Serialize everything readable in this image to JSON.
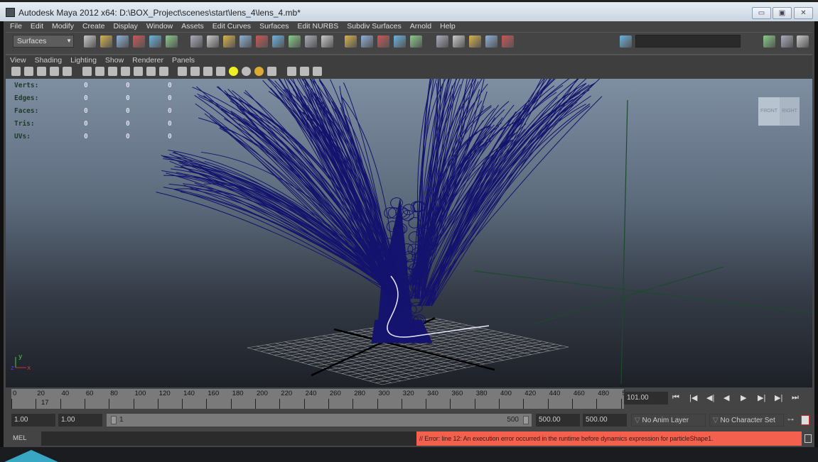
{
  "window": {
    "title": "Autodesk Maya 2012 x64: D:\\BOX_Project\\scenes\\start\\lens_4\\lens_4.mb*",
    "minimize": "▭",
    "maximize": "▣",
    "close": "✕"
  },
  "menu": [
    "File",
    "Edit",
    "Modify",
    "Create",
    "Display",
    "Window",
    "Assets",
    "Edit Curves",
    "Surfaces",
    "Edit NURBS",
    "Subdiv Surfaces",
    "Arnold",
    "Help"
  ],
  "toolbar": {
    "mode": "Surfaces",
    "icons": [
      "new-scene",
      "open-scene",
      "save-scene",
      "select-hierarchy",
      "select-object",
      "select-component",
      "move-tool",
      "select-tool",
      "lasso-tool",
      "paint-select",
      "snap-grid",
      "snap-curve",
      "snap-point",
      "snap-view-plane",
      "help",
      "lock",
      "input-ops",
      "history",
      "render",
      "ipr-render",
      "render-settings",
      "hypershade",
      "construction-history",
      "render-view",
      "show-outliner",
      "attribute-editor",
      "channel-box",
      "tool-settings",
      "layer-editor"
    ]
  },
  "panel": {
    "menu": [
      "View",
      "Shading",
      "Lighting",
      "Show",
      "Renderer",
      "Panels"
    ]
  },
  "hud": {
    "rows": [
      {
        "label": "Verts:",
        "values": [
          "0",
          "0",
          "0"
        ]
      },
      {
        "label": "Edges:",
        "values": [
          "0",
          "0",
          "0"
        ]
      },
      {
        "label": "Faces:",
        "values": [
          "0",
          "0",
          "0"
        ]
      },
      {
        "label": "Tris:",
        "values": [
          "0",
          "0",
          "0"
        ]
      },
      {
        "label": "UVs:",
        "values": [
          "0",
          "0",
          "0"
        ]
      }
    ]
  },
  "viewcube": {
    "front": "FRONT",
    "right": "RIGHT"
  },
  "axis": {
    "x": "x",
    "y": "y",
    "z": "z"
  },
  "timeline": {
    "ticks": [
      "0",
      "20",
      "40",
      "60",
      "80",
      "100",
      "120",
      "140",
      "160",
      "180",
      "200",
      "220",
      "240",
      "260",
      "280",
      "300",
      "320",
      "340",
      "360",
      "380",
      "400",
      "420",
      "440",
      "460",
      "480",
      "5"
    ],
    "current_marker": "17",
    "current_frame": "101.00"
  },
  "playback": [
    "⏮",
    "|◀",
    "◀|",
    "◀",
    "▶",
    "▶|",
    "▶|",
    "⏭"
  ],
  "range": {
    "start": "1.00",
    "playback_start": "1.00",
    "slider_start": "1",
    "slider_end": "500",
    "playback_end": "500.00",
    "end": "500.00",
    "anim_layer": "No Anim Layer",
    "character_set": "No Character Set"
  },
  "command": {
    "label": "MEL",
    "error": "// Error: line 12: An execution error occurred in the runtime before dynamics expression for particleShape1."
  },
  "colors": {
    "error": "#f3604e",
    "tree": "#14136e"
  }
}
